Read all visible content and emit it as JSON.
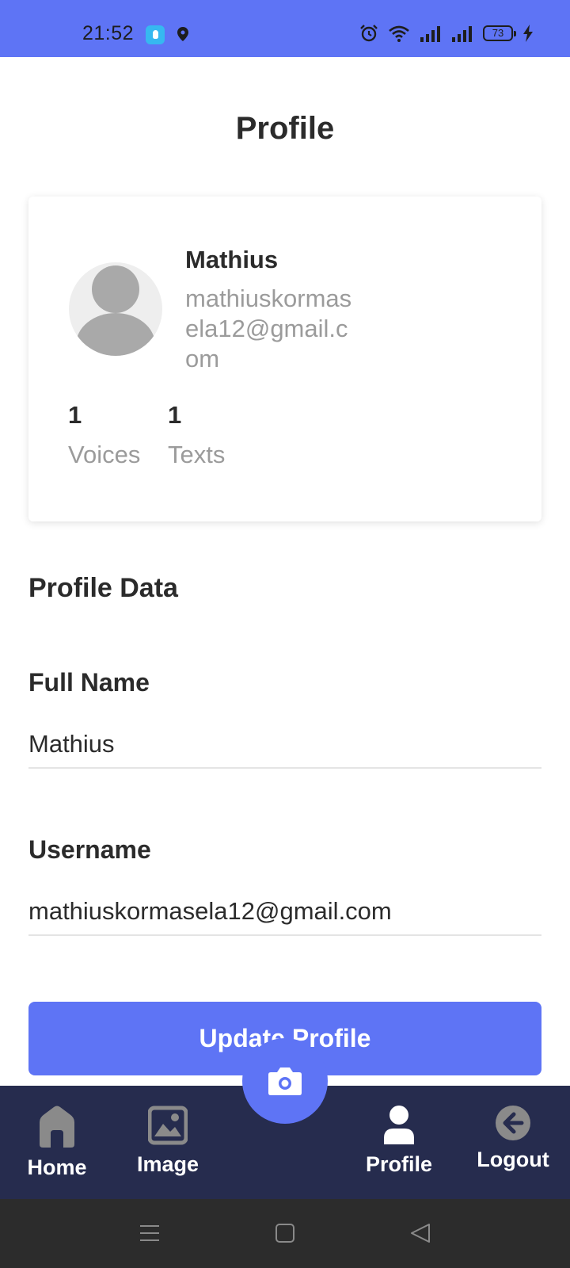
{
  "status_bar": {
    "time": "21:52",
    "battery": "73",
    "icons": [
      "app-notification-icon",
      "location-icon",
      "alarm-icon",
      "wifi-icon",
      "signal-icon",
      "signal-icon",
      "battery-icon",
      "charging-icon"
    ]
  },
  "page": {
    "title": "Profile"
  },
  "profile_card": {
    "name": "Mathius",
    "email": "mathiuskormasela12@gmail.com",
    "stats": [
      {
        "value": "1",
        "label": "Voices"
      },
      {
        "value": "1",
        "label": "Texts"
      }
    ]
  },
  "profile_data": {
    "title": "Profile Data",
    "full_name": {
      "label": "Full Name",
      "value": "Mathius"
    },
    "username": {
      "label": "Username",
      "value": "mathiuskormasela12@gmail.com"
    },
    "update_button": "Update Profile"
  },
  "bottom_nav": {
    "items": [
      {
        "label": "Home",
        "icon": "home-icon"
      },
      {
        "label": "Image",
        "icon": "image-icon"
      },
      {
        "label": "Profile",
        "icon": "user-icon"
      },
      {
        "label": "Logout",
        "icon": "logout-arrow-icon"
      }
    ],
    "fab_icon": "camera-icon"
  },
  "colors": {
    "primary": "#5e74f5",
    "nav_background": "#262c4e",
    "text_dark": "#2b2b2b",
    "text_muted": "#9b9b9b"
  }
}
